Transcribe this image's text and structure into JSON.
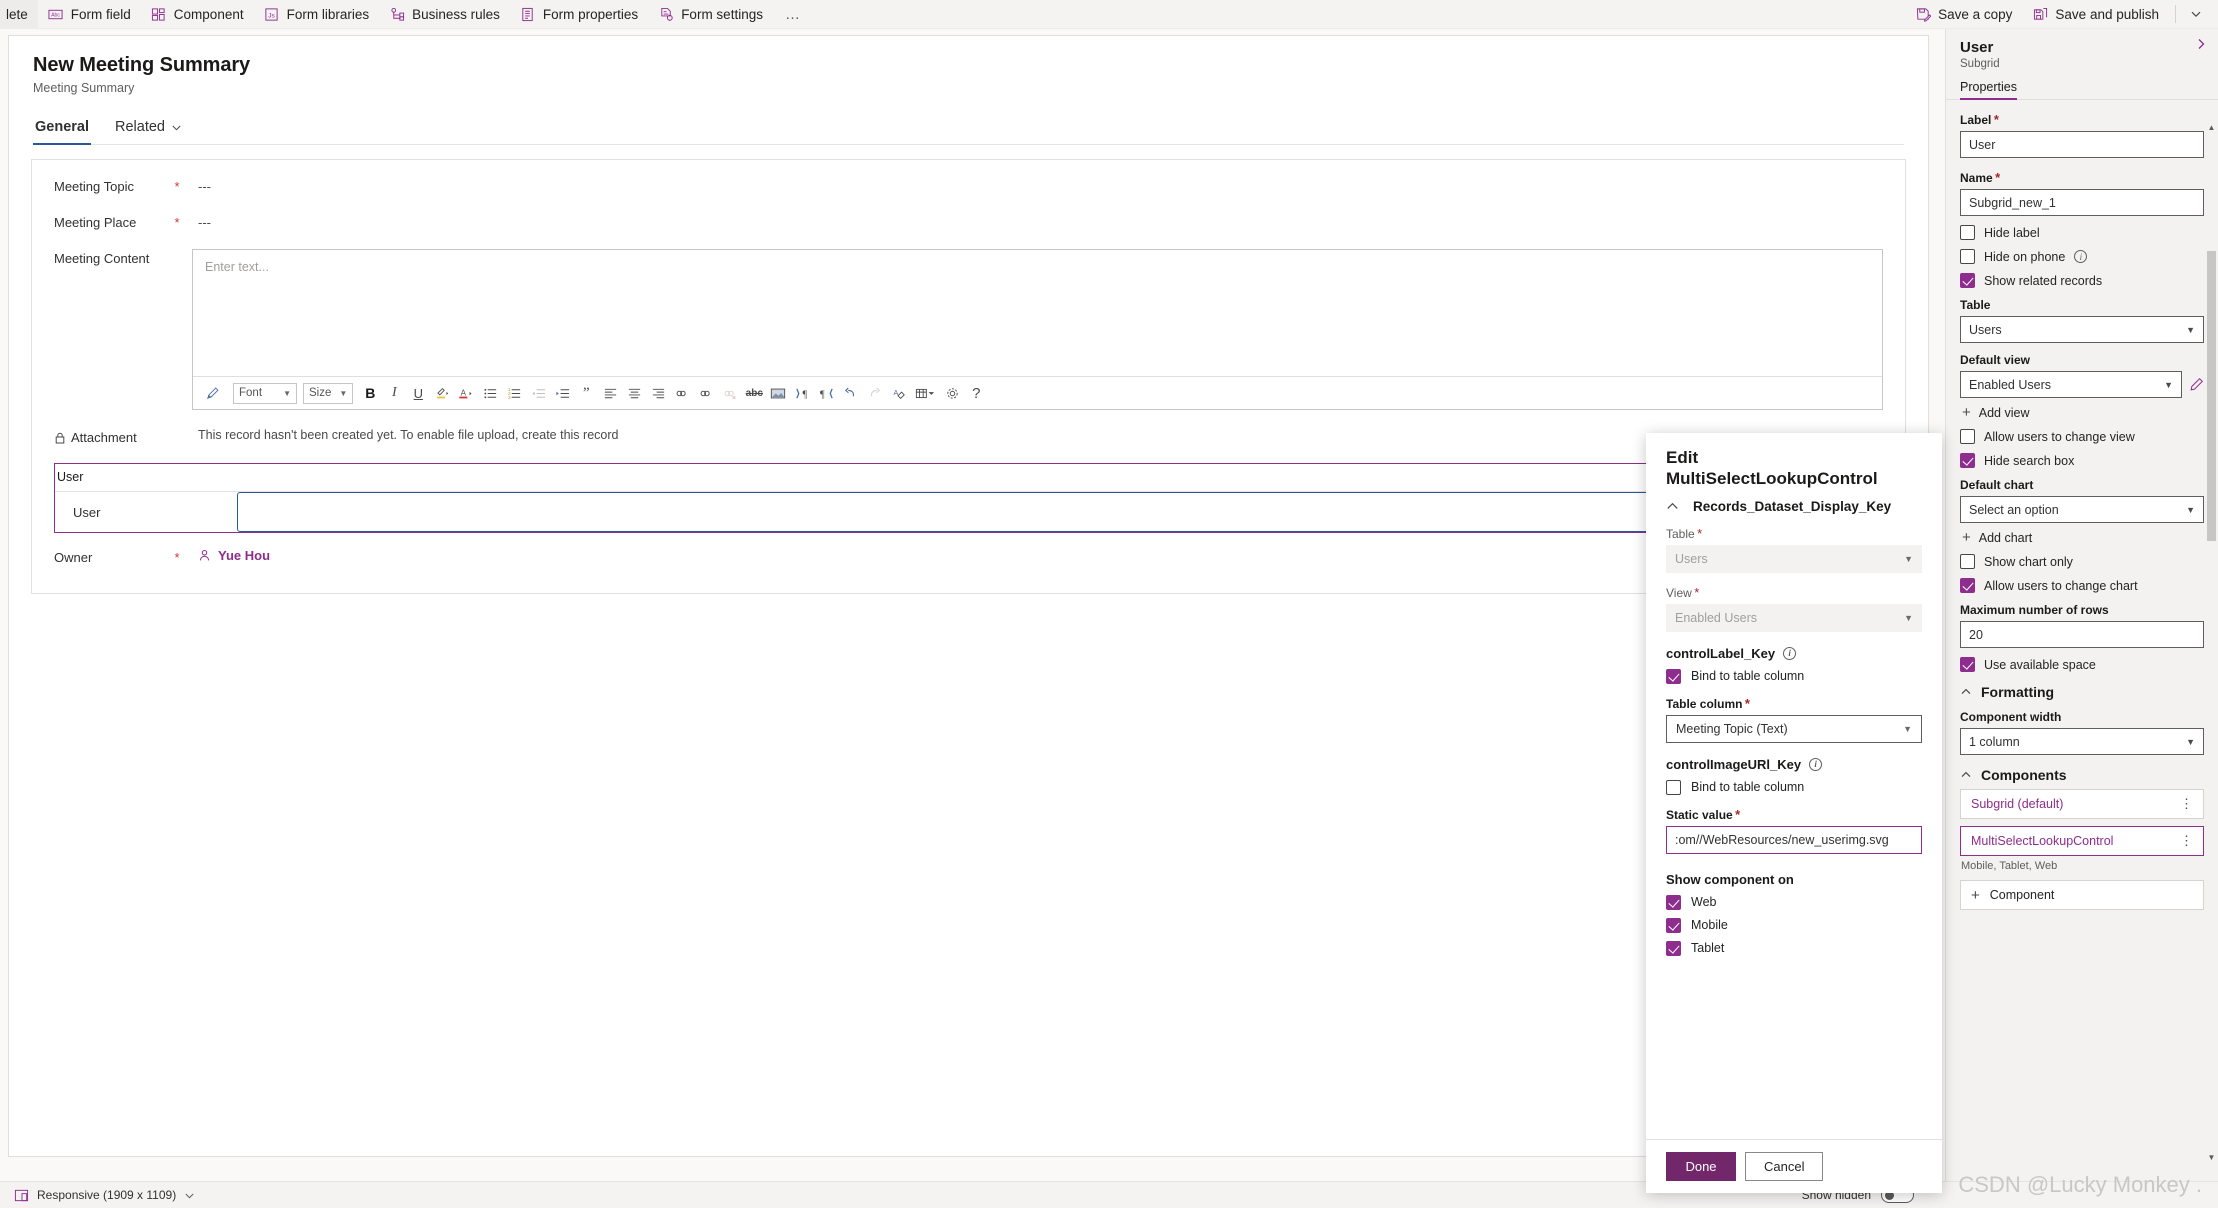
{
  "commandbar": {
    "left_items": [
      {
        "label": "lete",
        "icon": "delete-icon"
      },
      {
        "label": "Form field",
        "icon": "form-field-icon"
      },
      {
        "label": "Component",
        "icon": "component-icon"
      },
      {
        "label": "Form libraries",
        "icon": "js-icon"
      },
      {
        "label": "Business rules",
        "icon": "business-rules-icon"
      },
      {
        "label": "Form properties",
        "icon": "form-properties-icon"
      },
      {
        "label": "Form settings",
        "icon": "form-settings-icon"
      }
    ],
    "overflow": "…",
    "right_items": [
      {
        "label": "Save a copy",
        "icon": "save-a-copy-icon"
      },
      {
        "label": "Save and publish",
        "icon": "save-and-publish-icon"
      }
    ]
  },
  "form": {
    "title": "New Meeting Summary",
    "subtitle": "Meeting Summary",
    "tabs": [
      {
        "label": "General",
        "active": true
      },
      {
        "label": "Related",
        "active": false,
        "has_chevron": true
      }
    ],
    "fields": {
      "meeting_topic": {
        "label": "Meeting Topic",
        "required": true,
        "value": "---"
      },
      "meeting_place": {
        "label": "Meeting Place",
        "required": true,
        "value": "---"
      },
      "meeting_content": {
        "label": "Meeting Content",
        "required": false,
        "placeholder": "Enter text..."
      },
      "attachment": {
        "label": "Attachment",
        "note": "This record hasn't been created yet. To enable file upload, create this record"
      },
      "owner": {
        "label": "Owner",
        "required": true,
        "value": "Yue Hou"
      }
    },
    "subgrid": {
      "header": "User",
      "row_label": "User"
    },
    "rte_toolbar": {
      "font_label": "Font",
      "size_label": "Size",
      "buttons": [
        "format-painter-icon",
        "bold-icon",
        "italic-icon",
        "underline-icon",
        "highlight-color-icon",
        "font-color-icon",
        "bulleted-list-icon",
        "numbered-list-icon",
        "decrease-indent-icon",
        "increase-indent-icon",
        "blockquote-icon",
        "align-left-icon",
        "align-center-icon",
        "align-right-icon",
        "insert-link-icon",
        "remove-link-icon",
        "strikethrough-icon",
        "insert-image-icon",
        "ltr-icon",
        "rtl-icon",
        "undo-icon",
        "redo-icon",
        "clear-format-icon",
        "table-icon",
        "help-icon"
      ]
    }
  },
  "modal": {
    "title_line1": "Edit",
    "title_line2": "MultiSelectLookupControl",
    "accordion": "Records_Dataset_Display_Key",
    "table_label": "Table",
    "table_value": "Users",
    "view_label": "View",
    "view_value": "Enabled Users",
    "control_label_key": "controlLabel_Key",
    "bind_to_table_column": "Bind to table column",
    "bind_label_checked": true,
    "table_column_label": "Table column",
    "table_column_value": "Meeting Topic (Text)",
    "control_image_key": "controlImageURl_Key",
    "bind_image_checked": false,
    "static_value_label": "Static value",
    "static_value": ":om//WebResources/new_userimg.svg",
    "show_component_on": "Show component on",
    "platforms": [
      {
        "label": "Web",
        "checked": true
      },
      {
        "label": "Mobile",
        "checked": true
      },
      {
        "label": "Tablet",
        "checked": true
      }
    ],
    "done_label": "Done",
    "cancel_label": "Cancel"
  },
  "properties": {
    "title": "User",
    "subtitle": "Subgrid",
    "tab": "Properties",
    "label_field": {
      "label": "Label",
      "required": true,
      "value": "User"
    },
    "name_field": {
      "label": "Name",
      "required": true,
      "value": "Subgrid_new_1"
    },
    "checks_1": [
      {
        "label": "Hide label",
        "checked": false,
        "info": false
      },
      {
        "label": "Hide on phone",
        "checked": false,
        "info": true
      },
      {
        "label": "Show related records",
        "checked": true,
        "info": false
      }
    ],
    "table": {
      "label": "Table",
      "value": "Users"
    },
    "default_view": {
      "label": "Default view",
      "value": "Enabled Users"
    },
    "add_view": "Add view",
    "checks_2": [
      {
        "label": "Allow users to change view",
        "checked": false
      },
      {
        "label": "Hide search box",
        "checked": true
      }
    ],
    "default_chart": {
      "label": "Default chart",
      "value": "Select an option"
    },
    "add_chart": "Add chart",
    "checks_3": [
      {
        "label": "Show chart only",
        "checked": false
      },
      {
        "label": "Allow users to change chart",
        "checked": true
      }
    ],
    "max_rows": {
      "label": "Maximum number of rows",
      "value": "20"
    },
    "checks_4": [
      {
        "label": "Use available space",
        "checked": true
      }
    ],
    "formatting": {
      "title": "Formatting",
      "component_width_label": "Component width",
      "component_width_value": "1 column"
    },
    "components": {
      "title": "Components",
      "items": [
        {
          "label": "Subgrid (default)",
          "selected": false
        },
        {
          "label": "MultiSelectLookupControl",
          "selected": true
        }
      ],
      "note": "Mobile, Tablet, Web",
      "add_label": "Component"
    }
  },
  "statusbar": {
    "responsive": "Responsive (1909 x 1109)",
    "show_hidden": "Show hidden"
  },
  "watermark": "CSDN @Lucky Monkey ."
}
